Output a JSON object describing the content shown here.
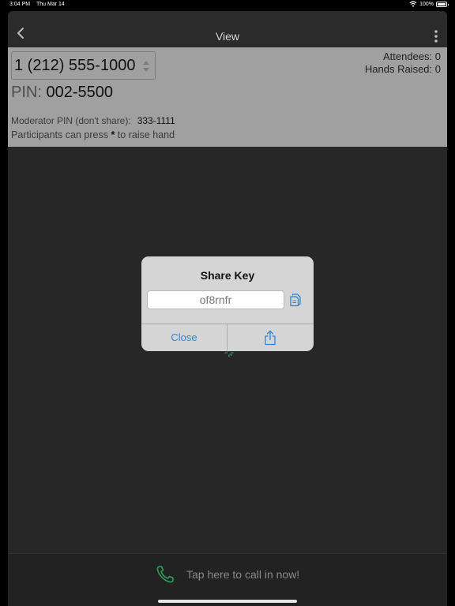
{
  "status_bar": {
    "time": "3:04 PM",
    "date": "Thu Mar 14",
    "battery": "100%"
  },
  "nav": {
    "title": "View",
    "back_icon": "chevron-left-icon",
    "menu_icon": "more-vertical-icon"
  },
  "conference": {
    "phone_number": "1 (212) 555-1000",
    "pin_label": "PIN:",
    "pin_value": "002-5500",
    "attendees": "Attendees: 0",
    "hands_raised": "Hands Raised: 0",
    "moderator_label": "Moderator PIN (don't share):",
    "moderator_value": "333-1111",
    "raise_prefix": "Participants can press ",
    "raise_key": "*",
    "raise_suffix": " to raise hand"
  },
  "dialog": {
    "title": "Share Key",
    "key_value": "of8rnfr",
    "close_label": "Close",
    "copy_icon": "copy-icon",
    "share_icon": "share-icon"
  },
  "bottom": {
    "call_text": "Tap here to call in now!",
    "phone_icon": "phone-icon"
  },
  "colors": {
    "accent": "#2f83d8",
    "call_green": "#2e9e5a",
    "info_panel": "#a0a0a0",
    "background": "#272727"
  }
}
